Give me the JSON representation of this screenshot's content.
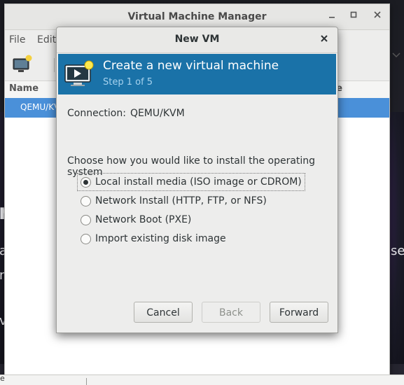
{
  "main_window": {
    "title": "Virtual Machine Manager",
    "menu": [
      "File",
      "Edit"
    ],
    "columns": {
      "name": "Name",
      "usage_fragment": "ge"
    },
    "vm_row": "QEMU/KV",
    "controls": [
      "minimize-icon",
      "maximize-icon",
      "close-icon"
    ]
  },
  "dialog": {
    "title": "New VM",
    "banner": {
      "title": "Create a new virtual machine",
      "step": "Step 1 of 5"
    },
    "connection_label": "Connection:",
    "connection_value": "QEMU/KVM",
    "prompt": "Choose how you would like to install the operating system",
    "options": [
      {
        "label": "Local install media (ISO image or CDROM)",
        "selected": true
      },
      {
        "label": "Network Install (HTTP, FTP, or NFS)",
        "selected": false
      },
      {
        "label": "Network Boot (PXE)",
        "selected": false
      },
      {
        "label": "Import existing disk image",
        "selected": false
      }
    ],
    "buttons": {
      "cancel": "Cancel",
      "back": "Back",
      "forward": "Forward"
    }
  },
  "background_fragments": {
    "left_big": "r",
    "left_a": "a",
    "left_n": "n",
    "left_v": "v",
    "left_e": "e",
    "right_se": "se",
    "top": "File Edit View Help"
  },
  "colors": {
    "banner": "#1a72a8",
    "selection": "#4a90d9"
  }
}
